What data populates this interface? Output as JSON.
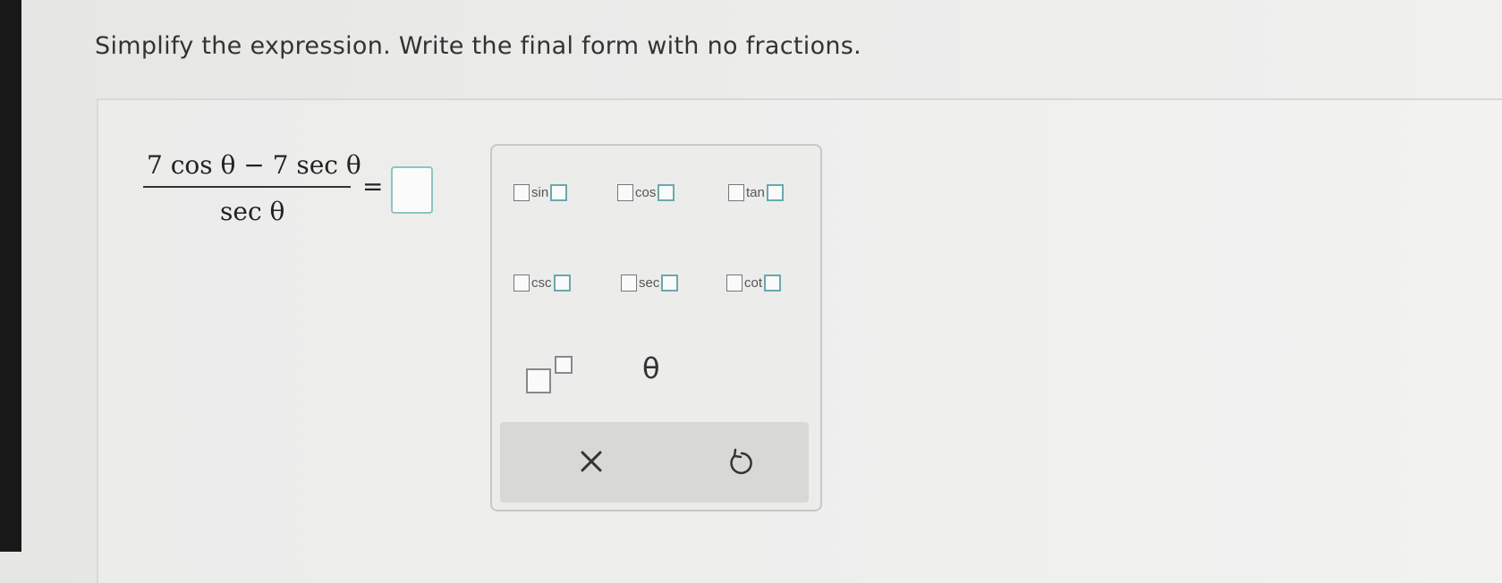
{
  "question": {
    "prompt": "Simplify the expression. Write the final form with no fractions."
  },
  "expression": {
    "numerator": "7 cos θ − 7 sec θ",
    "denominator": "sec θ",
    "equals": "="
  },
  "palette": {
    "functions": [
      {
        "label": "sin"
      },
      {
        "label": "cos"
      },
      {
        "label": "tan"
      },
      {
        "label": "csc"
      },
      {
        "label": "sec"
      },
      {
        "label": "cot"
      }
    ],
    "theta": "θ",
    "icons": {
      "clear": "x-icon",
      "undo": "undo-icon",
      "power": "exponent-template-icon"
    }
  },
  "colors": {
    "answer_box_border": "#8fc3c3",
    "template_box_teal": "#6aa9ad"
  }
}
